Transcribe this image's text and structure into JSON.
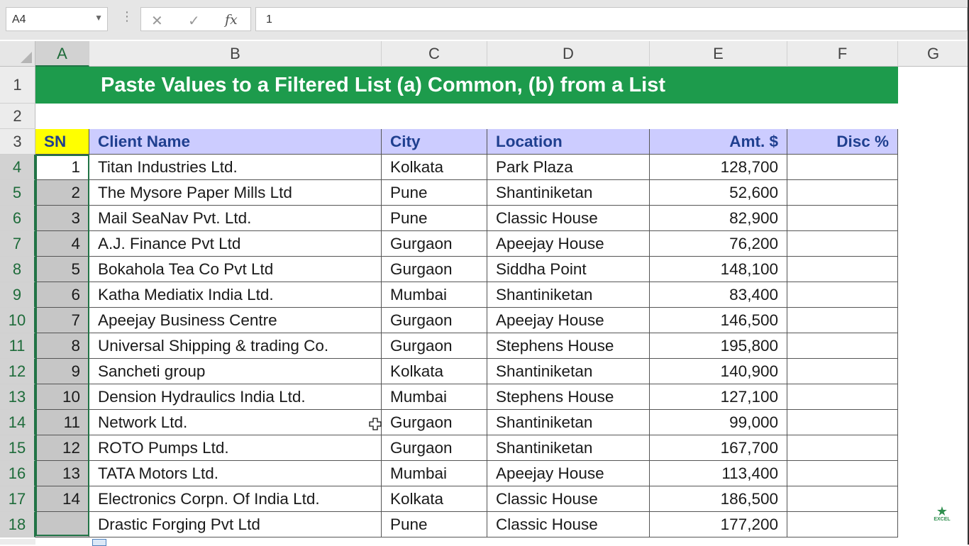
{
  "formula_bar": {
    "name_box": "A4",
    "cancel_icon": "✕",
    "enter_icon": "✓",
    "fx_icon": "fx",
    "content": "1"
  },
  "columns": [
    "A",
    "B",
    "C",
    "D",
    "E",
    "F",
    "G"
  ],
  "rows": [
    "1",
    "2",
    "3",
    "4",
    "5",
    "6",
    "7",
    "8",
    "9",
    "10",
    "11",
    "12",
    "13",
    "14",
    "15",
    "16",
    "17",
    "18"
  ],
  "title": "Paste Values to a Filtered List (a) Common, (b) from a List",
  "table": {
    "headers": {
      "sn": "SN",
      "client": "Client Name",
      "city": "City",
      "location": "Location",
      "amount": "Amt. $",
      "disc": "Disc %"
    },
    "rows": [
      {
        "sn": "1",
        "client": "Titan Industries Ltd.",
        "city": "Kolkata",
        "location": "Park Plaza",
        "amount": "128,700",
        "disc": ""
      },
      {
        "sn": "2",
        "client": "The Mysore Paper Mills Ltd",
        "city": "Pune",
        "location": "Shantiniketan",
        "amount": "52,600",
        "disc": ""
      },
      {
        "sn": "3",
        "client": "Mail SeaNav Pvt. Ltd.",
        "city": "Pune",
        "location": "Classic House",
        "amount": "82,900",
        "disc": ""
      },
      {
        "sn": "4",
        "client": "A.J. Finance Pvt Ltd",
        "city": "Gurgaon",
        "location": "Apeejay House",
        "amount": "76,200",
        "disc": ""
      },
      {
        "sn": "5",
        "client": "Bokahola Tea Co Pvt Ltd",
        "city": "Gurgaon",
        "location": "Siddha Point",
        "amount": "148,100",
        "disc": ""
      },
      {
        "sn": "6",
        "client": "Katha Mediatix India Ltd.",
        "city": "Mumbai",
        "location": "Shantiniketan",
        "amount": "83,400",
        "disc": ""
      },
      {
        "sn": "7",
        "client": "Apeejay Business Centre",
        "city": "Gurgaon",
        "location": "Apeejay House",
        "amount": "146,500",
        "disc": ""
      },
      {
        "sn": "8",
        "client": "Universal Shipping & trading Co.",
        "city": "Gurgaon",
        "location": "Stephens House",
        "amount": "195,800",
        "disc": ""
      },
      {
        "sn": "9",
        "client": "Sancheti group",
        "city": "Kolkata",
        "location": "Shantiniketan",
        "amount": "140,900",
        "disc": ""
      },
      {
        "sn": "10",
        "client": "Dension Hydraulics India Ltd.",
        "city": "Mumbai",
        "location": "Stephens House",
        "amount": "127,100",
        "disc": ""
      },
      {
        "sn": "11",
        "client": "Network Ltd.",
        "city": "Gurgaon",
        "location": "Shantiniketan",
        "amount": "99,000",
        "disc": ""
      },
      {
        "sn": "12",
        "client": "ROTO Pumps Ltd.",
        "city": "Gurgaon",
        "location": "Shantiniketan",
        "amount": "167,700",
        "disc": ""
      },
      {
        "sn": "13",
        "client": "TATA Motors Ltd.",
        "city": "Mumbai",
        "location": "Apeejay House",
        "amount": "113,400",
        "disc": ""
      },
      {
        "sn": "14",
        "client": "Electronics Corpn. Of India Ltd.",
        "city": "Kolkata",
        "location": "Classic House",
        "amount": "186,500",
        "disc": ""
      },
      {
        "sn": "",
        "client": "Drastic Forging Pvt Ltd",
        "city": "Pune",
        "location": "Classic House",
        "amount": "177,200",
        "disc": ""
      }
    ]
  },
  "logo_text": "EXCEL",
  "colors": {
    "title_bg": "#1d9b4c",
    "header_bg": "#ccccff",
    "sn_bg": "#ffff00",
    "selection": "#217346"
  }
}
